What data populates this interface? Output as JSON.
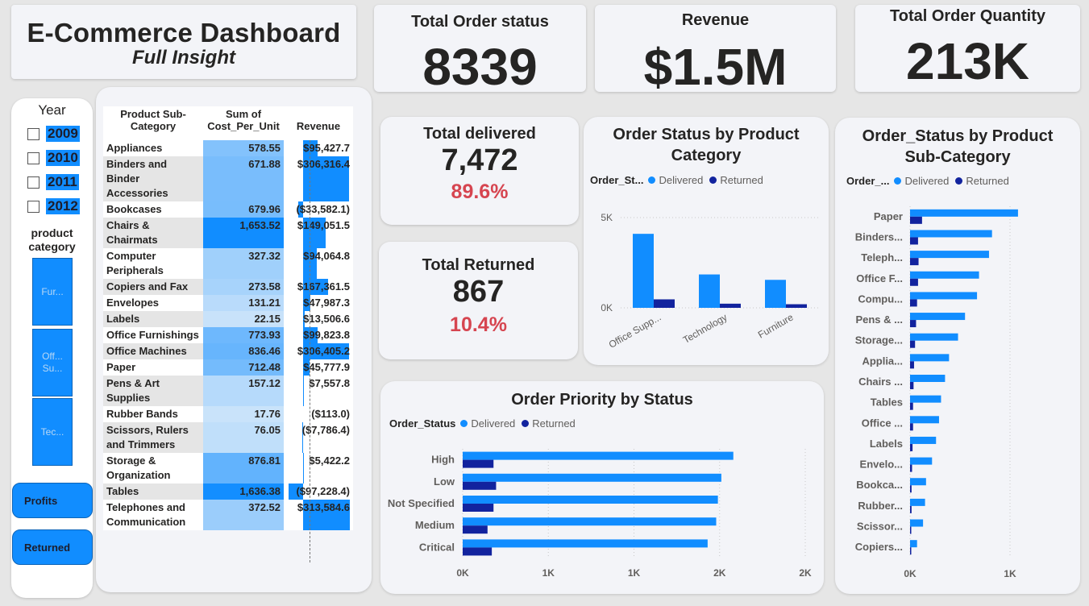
{
  "header": {
    "title": "E-Commerce Dashboard",
    "subtitle": "Full Insight"
  },
  "kpis": [
    {
      "title": "Total Order status",
      "value": "8339"
    },
    {
      "title": "Revenue",
      "value": "$1.5M"
    },
    {
      "title": "Total Order Quantity",
      "value": "213K"
    }
  ],
  "delivered": {
    "title": "Total delivered",
    "value": "7,472",
    "pct": "89.6%"
  },
  "returned": {
    "title": "Total Returned",
    "value": "867",
    "pct": "10.4%"
  },
  "slicer": {
    "year_label": "Year",
    "years": [
      "2009",
      "2010",
      "2011",
      "2012"
    ],
    "category_label": "product category",
    "categories": [
      "Fur...",
      "Off... Su...",
      "Tec..."
    ]
  },
  "buttons": {
    "profits": "Profits",
    "returned": "Returned"
  },
  "table": {
    "headers": [
      "Product Sub-Category",
      "Sum of Cost_Per_Unit",
      "Revenue"
    ],
    "rows": [
      {
        "name": "Appliances",
        "cost": "578.55",
        "revenue": "$95,427.7",
        "cost_val": 578.55,
        "rev_val": 95427.7
      },
      {
        "name": "Binders and Binder Accessories",
        "cost": "671.88",
        "revenue": "$306,316.4",
        "cost_val": 671.88,
        "rev_val": 306316.4
      },
      {
        "name": "Bookcases",
        "cost": "679.96",
        "revenue": "($33,582.1)",
        "cost_val": 679.96,
        "rev_val": -33582.1
      },
      {
        "name": "Chairs & Chairmats",
        "cost": "1,653.52",
        "revenue": "$149,051.5",
        "cost_val": 1653.52,
        "rev_val": 149051.5
      },
      {
        "name": "Computer Peripherals",
        "cost": "327.32",
        "revenue": "$94,064.8",
        "cost_val": 327.32,
        "rev_val": 94064.8
      },
      {
        "name": "Copiers and Fax",
        "cost": "273.58",
        "revenue": "$167,361.5",
        "cost_val": 273.58,
        "rev_val": 167361.5
      },
      {
        "name": "Envelopes",
        "cost": "131.21",
        "revenue": "$47,987.3",
        "cost_val": 131.21,
        "rev_val": 47987.3
      },
      {
        "name": "Labels",
        "cost": "22.15",
        "revenue": "$13,506.6",
        "cost_val": 22.15,
        "rev_val": 13506.6
      },
      {
        "name": "Office Furnishings",
        "cost": "773.93",
        "revenue": "$99,823.8",
        "cost_val": 773.93,
        "rev_val": 99823.8
      },
      {
        "name": "Office Machines",
        "cost": "836.46",
        "revenue": "$306,405.2",
        "cost_val": 836.46,
        "rev_val": 306405.2
      },
      {
        "name": "Paper",
        "cost": "712.48",
        "revenue": "$45,777.9",
        "cost_val": 712.48,
        "rev_val": 45777.9
      },
      {
        "name": "Pens & Art Supplies",
        "cost": "157.12",
        "revenue": "$7,557.8",
        "cost_val": 157.12,
        "rev_val": 7557.8
      },
      {
        "name": "Rubber Bands",
        "cost": "17.76",
        "revenue": "($113.0)",
        "cost_val": 17.76,
        "rev_val": -113.0
      },
      {
        "name": "Scissors, Rulers and Trimmers",
        "cost": "76.05",
        "revenue": "($7,786.4)",
        "cost_val": 76.05,
        "rev_val": -7786.4
      },
      {
        "name": "Storage & Organization",
        "cost": "876.81",
        "revenue": "$5,422.2",
        "cost_val": 876.81,
        "rev_val": 5422.2
      },
      {
        "name": "Tables",
        "cost": "1,636.38",
        "revenue": "($97,228.4)",
        "cost_val": 1636.38,
        "rev_val": -97228.4
      },
      {
        "name": "Telephones and Communication",
        "cost": "372.52",
        "revenue": "$313,584.6",
        "cost_val": 372.52,
        "rev_val": 313584.6
      }
    ]
  },
  "colors": {
    "delivered": "#118dff",
    "returned": "#12239e",
    "accent_red": "#d64550"
  },
  "chart_data": [
    {
      "type": "bar",
      "title": "Order Status by Product Category",
      "legend_title": "Order_St...",
      "categories": [
        "Office Supp...",
        "Technology",
        "Furniture"
      ],
      "series": [
        {
          "name": "Delivered",
          "values": [
            4100,
            1850,
            1550
          ]
        },
        {
          "name": "Returned",
          "values": [
            470,
            230,
            200
          ]
        }
      ],
      "y_ticks": [
        "0K",
        "5K"
      ],
      "ylim": [
        0,
        5000
      ]
    },
    {
      "type": "bar",
      "orientation": "horizontal",
      "title": "Order Priority by Status",
      "legend_title": "Order_Status",
      "categories": [
        "High",
        "Low",
        "Not Specified",
        "Medium",
        "Critical"
      ],
      "series": [
        {
          "name": "Delivered",
          "values": [
            1580,
            1510,
            1490,
            1480,
            1430
          ]
        },
        {
          "name": "Returned",
          "values": [
            180,
            195,
            180,
            145,
            170
          ]
        }
      ],
      "x_ticks": [
        "0K",
        "1K",
        "1K",
        "2K",
        "2K"
      ],
      "xlim": [
        0,
        2000
      ]
    },
    {
      "type": "bar",
      "orientation": "horizontal",
      "title": "Order_Status by Product Sub-Category",
      "legend_title": "Order_...",
      "categories": [
        "Paper",
        "Binders...",
        "Teleph...",
        "Office F...",
        "Compu...",
        "Pens & ...",
        "Storage...",
        "Applia...",
        "Chairs ...",
        "Tables",
        "Office ...",
        "Labels",
        "Envelo...",
        "Bookca...",
        "Rubber...",
        "Scissor...",
        "Copiers..."
      ],
      "series": [
        {
          "name": "Delivered",
          "values": [
            1080,
            820,
            790,
            690,
            670,
            550,
            480,
            390,
            350,
            310,
            290,
            260,
            220,
            160,
            150,
            130,
            70
          ]
        },
        {
          "name": "Returned",
          "values": [
            120,
            80,
            85,
            80,
            70,
            60,
            50,
            40,
            35,
            30,
            30,
            25,
            20,
            15,
            15,
            10,
            5
          ]
        }
      ],
      "x_ticks": [
        "0K",
        "1K"
      ],
      "xlim": [
        0,
        1000
      ]
    }
  ]
}
